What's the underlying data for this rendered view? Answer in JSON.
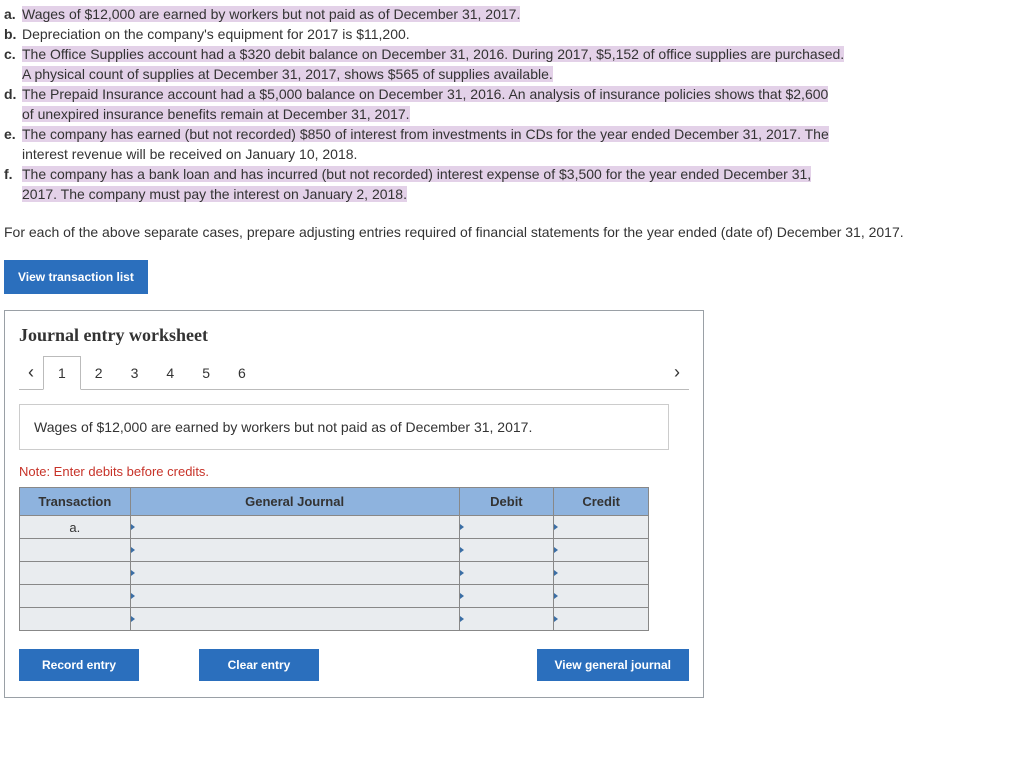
{
  "cases": [
    {
      "letter": "a.",
      "text": "Wages of $12,000 are earned by workers but not paid as of December 31, 2017.",
      "hl": true
    },
    {
      "letter": "b.",
      "text": "Depreciation on the company's equipment for 2017 is $11,200.",
      "hl": false
    },
    {
      "letter": "c.",
      "text": "The Office Supplies account had a $320 debit balance on December 31, 2016. During 2017, $5,152 of office supplies are purchased.",
      "hl": true,
      "line2": "A physical count of supplies at December 31, 2017, shows $565 of supplies available.",
      "line2hl": true
    },
    {
      "letter": "d.",
      "text": "The Prepaid Insurance account had a $5,000 balance on December 31, 2016. An analysis of insurance policies shows that $2,600",
      "hl": true,
      "line2": "of unexpired insurance benefits remain at December 31, 2017.",
      "line2hl": true
    },
    {
      "letter": "e.",
      "text": "The company has earned (but not recorded) $850 of interest from investments in CDs for the year ended December 31, 2017. The",
      "hl": true,
      "line2": "interest revenue will be received on January 10, 2018.",
      "line2hl": false
    },
    {
      "letter": "f.",
      "text": "The company has a bank loan and has incurred (but not recorded) interest expense of $3,500 for the year ended December 31,",
      "hl": true,
      "line2": "2017. The company must pay the interest on January 2, 2018.",
      "line2hl": true
    }
  ],
  "instruction": "For each of the above separate cases, prepare adjusting entries required of financial statements for the year ended (date of) December 31, 2017.",
  "buttons": {
    "view_trans_list": "View transaction list",
    "record_entry": "Record entry",
    "clear_entry": "Clear entry",
    "view_general_journal": "View general journal"
  },
  "worksheet": {
    "title": "Journal entry worksheet",
    "tabs": [
      "1",
      "2",
      "3",
      "4",
      "5",
      "6"
    ],
    "active_tab": "1",
    "description": "Wages of $12,000 are earned by workers but not paid as of December 31, 2017.",
    "note": "Note: Enter debits before credits.",
    "headers": {
      "transaction": "Transaction",
      "general_journal": "General Journal",
      "debit": "Debit",
      "credit": "Credit"
    },
    "first_trans": "a."
  }
}
